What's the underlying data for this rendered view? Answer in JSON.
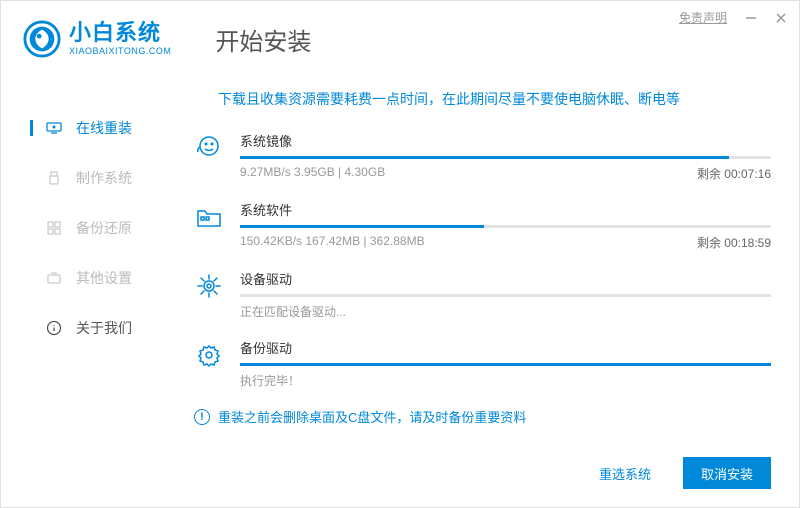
{
  "header": {
    "brand_name": "小白系统",
    "brand_sub": "XIAOBAIXITONG.COM",
    "install_title": "开始安装",
    "disclaimer": "免责声明"
  },
  "sidebar": {
    "items": [
      {
        "label": "在线重装"
      },
      {
        "label": "制作系统"
      },
      {
        "label": "备份还原"
      },
      {
        "label": "其他设置"
      },
      {
        "label": "关于我们"
      }
    ]
  },
  "main": {
    "hint": "下载且收集资源需要耗费一点时间，在此期间尽量不要使电脑休眠、断电等",
    "tasks": [
      {
        "title": "系统镜像",
        "detail": "9.27MB/s 3.95GB | 4.30GB",
        "remain": "剩余 00:07:16",
        "progress": 92
      },
      {
        "title": "系统软件",
        "detail": "150.42KB/s 167.42MB | 362.88MB",
        "remain": "剩余 00:18:59",
        "progress": 46
      },
      {
        "title": "设备驱动",
        "detail": "正在匹配设备驱动...",
        "remain": "",
        "progress": 0
      },
      {
        "title": "备份驱动",
        "detail": "执行完毕！",
        "remain": "",
        "progress": 100
      }
    ],
    "warning": "重装之前会删除桌面及C盘文件，请及时备份重要资料"
  },
  "footer": {
    "reselect": "重选系统",
    "cancel": "取消安装"
  }
}
